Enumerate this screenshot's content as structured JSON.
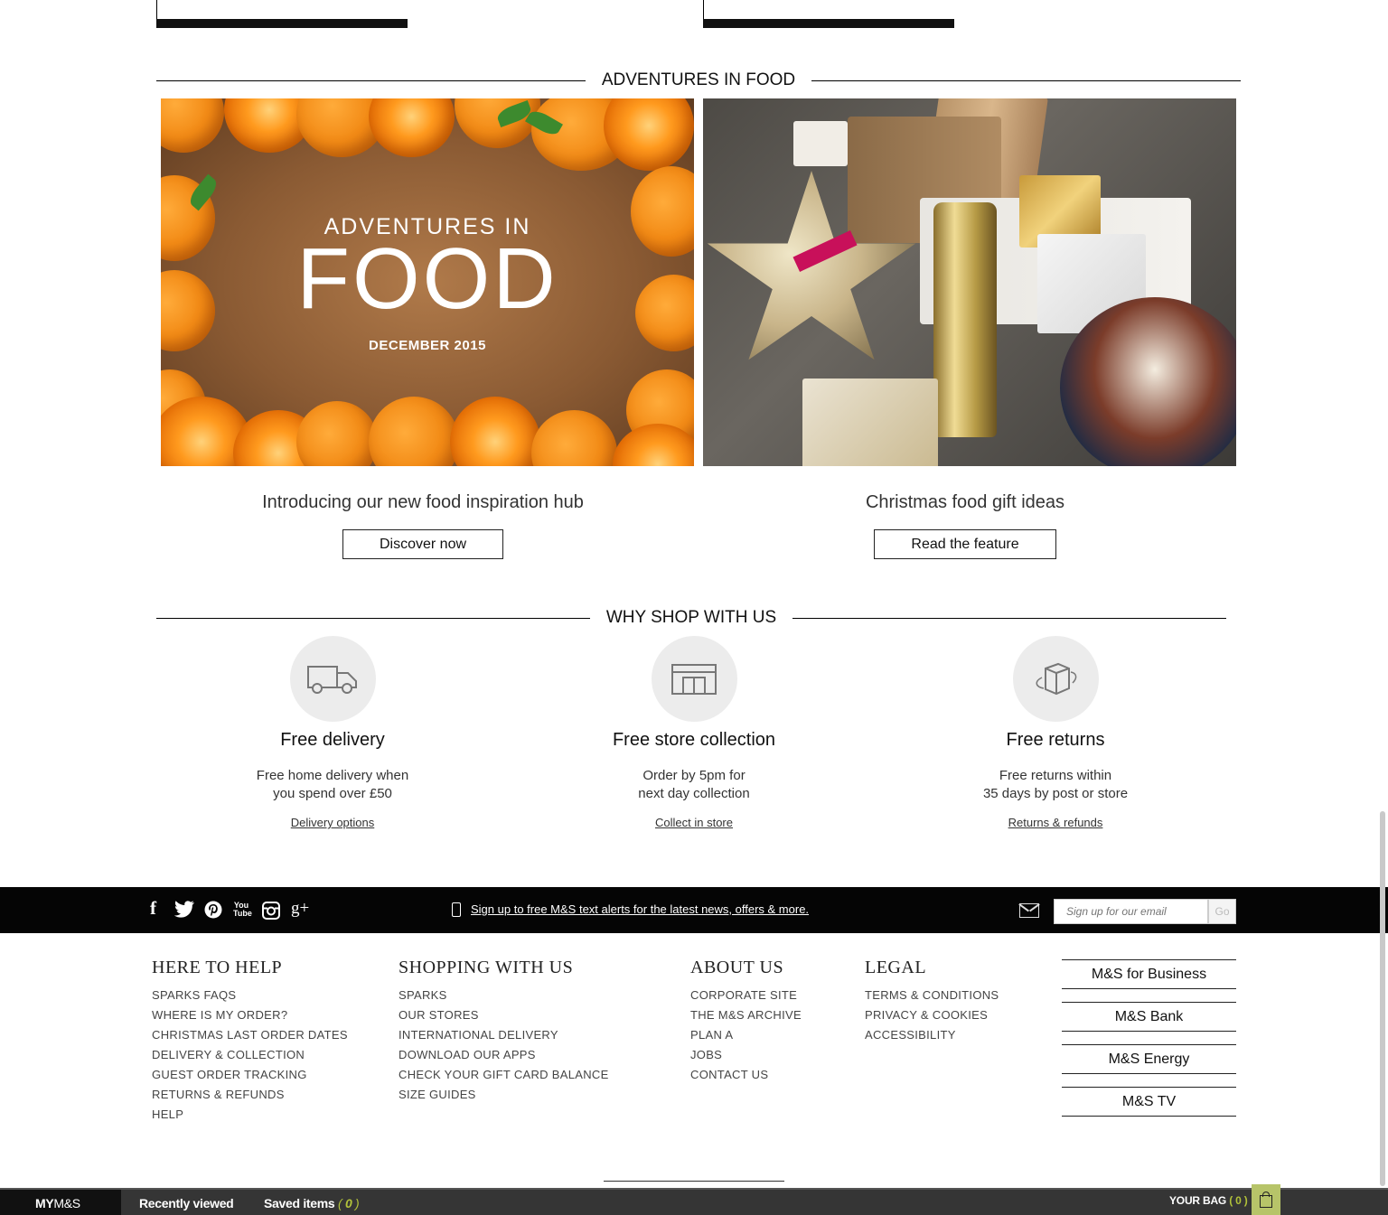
{
  "sections": {
    "adventures_heading": "ADVENTURES IN FOOD",
    "why_heading": "WHY SHOP WITH US"
  },
  "features": [
    {
      "hero_small": "ADVENTURES IN",
      "hero_big": "FOOD",
      "hero_date": "DECEMBER 2015",
      "caption": "Introducing our new food inspiration hub",
      "button": "Discover now"
    },
    {
      "caption": "Christmas food gift ideas",
      "button": "Read the feature"
    }
  ],
  "why": [
    {
      "icon": "delivery-van-icon",
      "title": "Free delivery",
      "line1": "Free home delivery when",
      "line2": "you spend over £50",
      "link": "Delivery options"
    },
    {
      "icon": "store-icon",
      "title": "Free store collection",
      "line1": "Order by 5pm for",
      "line2": "next day collection",
      "link": "Collect in store"
    },
    {
      "icon": "returns-box-icon",
      "title": "Free returns",
      "line1": "Free returns within",
      "line2": "35 days by post or store",
      "link": "Returns & refunds"
    }
  ],
  "social_bar": {
    "icons": [
      "facebook-icon",
      "twitter-icon",
      "pinterest-icon",
      "youtube-icon",
      "instagram-icon",
      "google-plus-icon"
    ],
    "facebook": "f",
    "youtube": "You Tube",
    "google_plus": "g+",
    "sms_text": "Sign up to free M&S text alerts for the latest news, offers & more.",
    "email_placeholder": "Sign up for our email",
    "go": "Go"
  },
  "footer": {
    "help": {
      "title": "HERE TO HELP",
      "links": [
        "SPARKS FAQS",
        "WHERE IS MY ORDER?",
        "CHRISTMAS LAST ORDER DATES",
        "DELIVERY & COLLECTION",
        "GUEST ORDER TRACKING",
        "RETURNS & REFUNDS",
        "HELP"
      ]
    },
    "shopping": {
      "title": "SHOPPING WITH US",
      "links": [
        "SPARKS",
        "OUR STORES",
        "INTERNATIONAL DELIVERY",
        "DOWNLOAD OUR APPS",
        "CHECK YOUR GIFT CARD BALANCE",
        "SIZE GUIDES"
      ]
    },
    "about": {
      "title": "ABOUT US",
      "links": [
        "CORPORATE SITE",
        "THE M&S ARCHIVE",
        "PLAN A",
        "JOBS",
        "CONTACT US"
      ]
    },
    "legal": {
      "title": "LEGAL",
      "links": [
        "TERMS & CONDITIONS",
        "PRIVACY & COOKIES",
        "ACCESSIBILITY"
      ]
    },
    "side_links": [
      "M&S for Business",
      "M&S Bank",
      "M&S Energy",
      "M&S TV"
    ]
  },
  "sticky_bar": {
    "my_prefix": "MY",
    "my_brand": "M&S",
    "recently_viewed": "Recently viewed",
    "saved_items": "Saved items",
    "saved_open": "( ",
    "saved_count": "0",
    "saved_close": " )",
    "bag_label": "YOUR BAG",
    "bag_open": " ( ",
    "bag_count": "0",
    "bag_close": " )"
  },
  "colors": {
    "accent_green": "#b2c23a",
    "bar_black": "#050505",
    "sticky_bg": "#353535"
  }
}
